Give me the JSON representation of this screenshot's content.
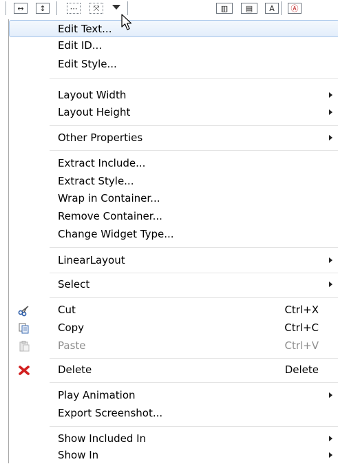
{
  "menu": {
    "items": [
      {
        "label": "Edit Text..."
      },
      {
        "label": "Edit ID..."
      },
      {
        "label": "Edit Style..."
      },
      {
        "label": "Layout Width"
      },
      {
        "label": "Layout Height"
      },
      {
        "label": "Other Properties"
      },
      {
        "label": "Extract Include..."
      },
      {
        "label": "Extract Style..."
      },
      {
        "label": "Wrap in Container..."
      },
      {
        "label": "Remove Container..."
      },
      {
        "label": "Change Widget Type..."
      },
      {
        "label": "LinearLayout"
      },
      {
        "label": "Select"
      },
      {
        "label": "Cut",
        "shortcut": "Ctrl+X"
      },
      {
        "label": "Copy",
        "shortcut": "Ctrl+C"
      },
      {
        "label": "Paste",
        "shortcut": "Ctrl+V"
      },
      {
        "label": "Delete",
        "shortcut": "Delete"
      },
      {
        "label": "Play Animation"
      },
      {
        "label": "Export Screenshot..."
      },
      {
        "label": "Show Included In"
      },
      {
        "label": "Show In"
      }
    ]
  },
  "icons": {
    "cut": "scissors-icon",
    "copy": "copy-icon",
    "paste": "paste-icon",
    "delete": "delete-x-icon"
  },
  "colors": {
    "highlight_border": "#a9c7ea",
    "highlight_fill": "#e3eefb",
    "disabled_text": "#8d8d8d",
    "delete_icon": "#d21f1f"
  }
}
